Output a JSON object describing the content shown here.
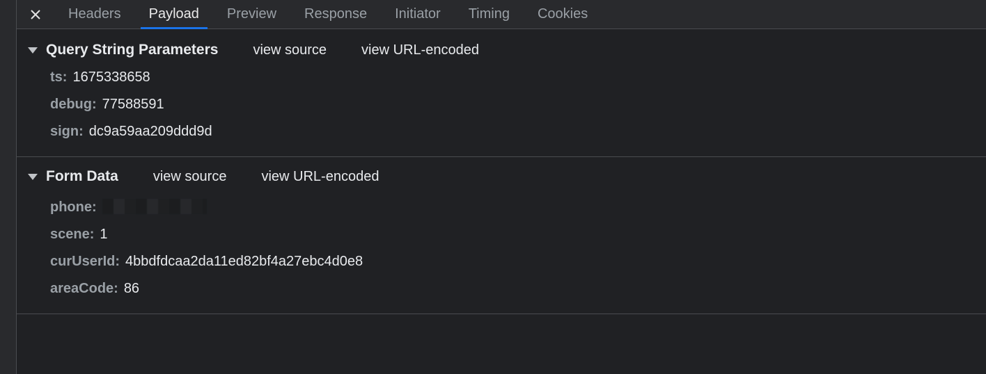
{
  "tabs": {
    "headers": "Headers",
    "payload": "Payload",
    "preview": "Preview",
    "response": "Response",
    "initiator": "Initiator",
    "timing": "Timing",
    "cookies": "Cookies"
  },
  "sections": {
    "query": {
      "title": "Query String Parameters",
      "view_source": "view source",
      "view_url_encoded": "view URL-encoded",
      "items": [
        {
          "k": "ts:",
          "v": "1675338658"
        },
        {
          "k": "debug:",
          "v": "77588591"
        },
        {
          "k": "sign:",
          "v": "dc9a59aa209ddd9d"
        }
      ]
    },
    "form": {
      "title": "Form Data",
      "view_source": "view source",
      "view_url_encoded": "view URL-encoded",
      "items": [
        {
          "k": "phone:",
          "v": ""
        },
        {
          "k": "scene:",
          "v": "1"
        },
        {
          "k": "curUserId:",
          "v": "4bbdfdcaa2da11ed82bf4a27ebc4d0e8"
        },
        {
          "k": "areaCode:",
          "v": "86"
        }
      ]
    }
  }
}
